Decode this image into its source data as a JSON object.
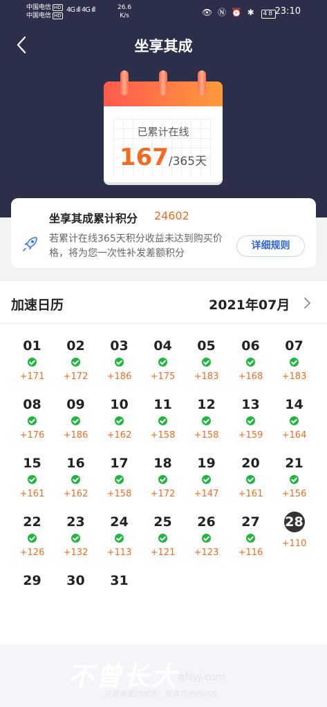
{
  "status_bar": {
    "carrier1": "中国电信",
    "carrier2": "中国电信",
    "hd": "HD",
    "signal": "4G ıll 4G ıll",
    "speed_value": "26.6",
    "speed_unit": "K/s",
    "icons": "👁 Ⓝ ⏰ ✱",
    "battery": "48",
    "time": "23:10"
  },
  "header": {
    "title": "坐享其成"
  },
  "calendar_badge": {
    "label": "已累计在线",
    "count": "167",
    "total": "/365天"
  },
  "points_card": {
    "title": "坐享其成累计积分",
    "value": "24602",
    "description": "若累计在线365天积分收益未达到购买价格，将为您一次性补发差额积分",
    "rules_button": "详细规则"
  },
  "accel_calendar": {
    "title": "加速日历",
    "month": "2021年07月",
    "today": "28",
    "days": [
      {
        "day": "01",
        "pts": "+171"
      },
      {
        "day": "02",
        "pts": "+172"
      },
      {
        "day": "03",
        "pts": "+186"
      },
      {
        "day": "04",
        "pts": "+175"
      },
      {
        "day": "05",
        "pts": "+183"
      },
      {
        "day": "06",
        "pts": "+168"
      },
      {
        "day": "07",
        "pts": "+183"
      },
      {
        "day": "08",
        "pts": "+176"
      },
      {
        "day": "09",
        "pts": "+186"
      },
      {
        "day": "10",
        "pts": "+162"
      },
      {
        "day": "11",
        "pts": "+158"
      },
      {
        "day": "12",
        "pts": "+158"
      },
      {
        "day": "13",
        "pts": "+159"
      },
      {
        "day": "14",
        "pts": "+164"
      },
      {
        "day": "15",
        "pts": "+161"
      },
      {
        "day": "16",
        "pts": "+162"
      },
      {
        "day": "17",
        "pts": "+158"
      },
      {
        "day": "18",
        "pts": "+172"
      },
      {
        "day": "19",
        "pts": "+147"
      },
      {
        "day": "20",
        "pts": "+161"
      },
      {
        "day": "21",
        "pts": "+156"
      },
      {
        "day": "22",
        "pts": "+126"
      },
      {
        "day": "23",
        "pts": "+132"
      },
      {
        "day": "24",
        "pts": "+113"
      },
      {
        "day": "25",
        "pts": "+121"
      },
      {
        "day": "26",
        "pts": "+123"
      },
      {
        "day": "27",
        "pts": "+116"
      },
      {
        "day": "28",
        "pts": "+110"
      },
      {
        "day": "29",
        "pts": ""
      },
      {
        "day": "30",
        "pts": ""
      },
      {
        "day": "31",
        "pts": ""
      }
    ]
  },
  "watermark": {
    "main": "不曾长大",
    "site": "qfsyj.com",
    "sub": "只要有爱的地方，就有守护的存在"
  },
  "colors": {
    "header_bg": "#2c2f4a",
    "accent_orange": "#f26b21",
    "check_green": "#1fb740",
    "link_blue": "#2d63d8"
  }
}
